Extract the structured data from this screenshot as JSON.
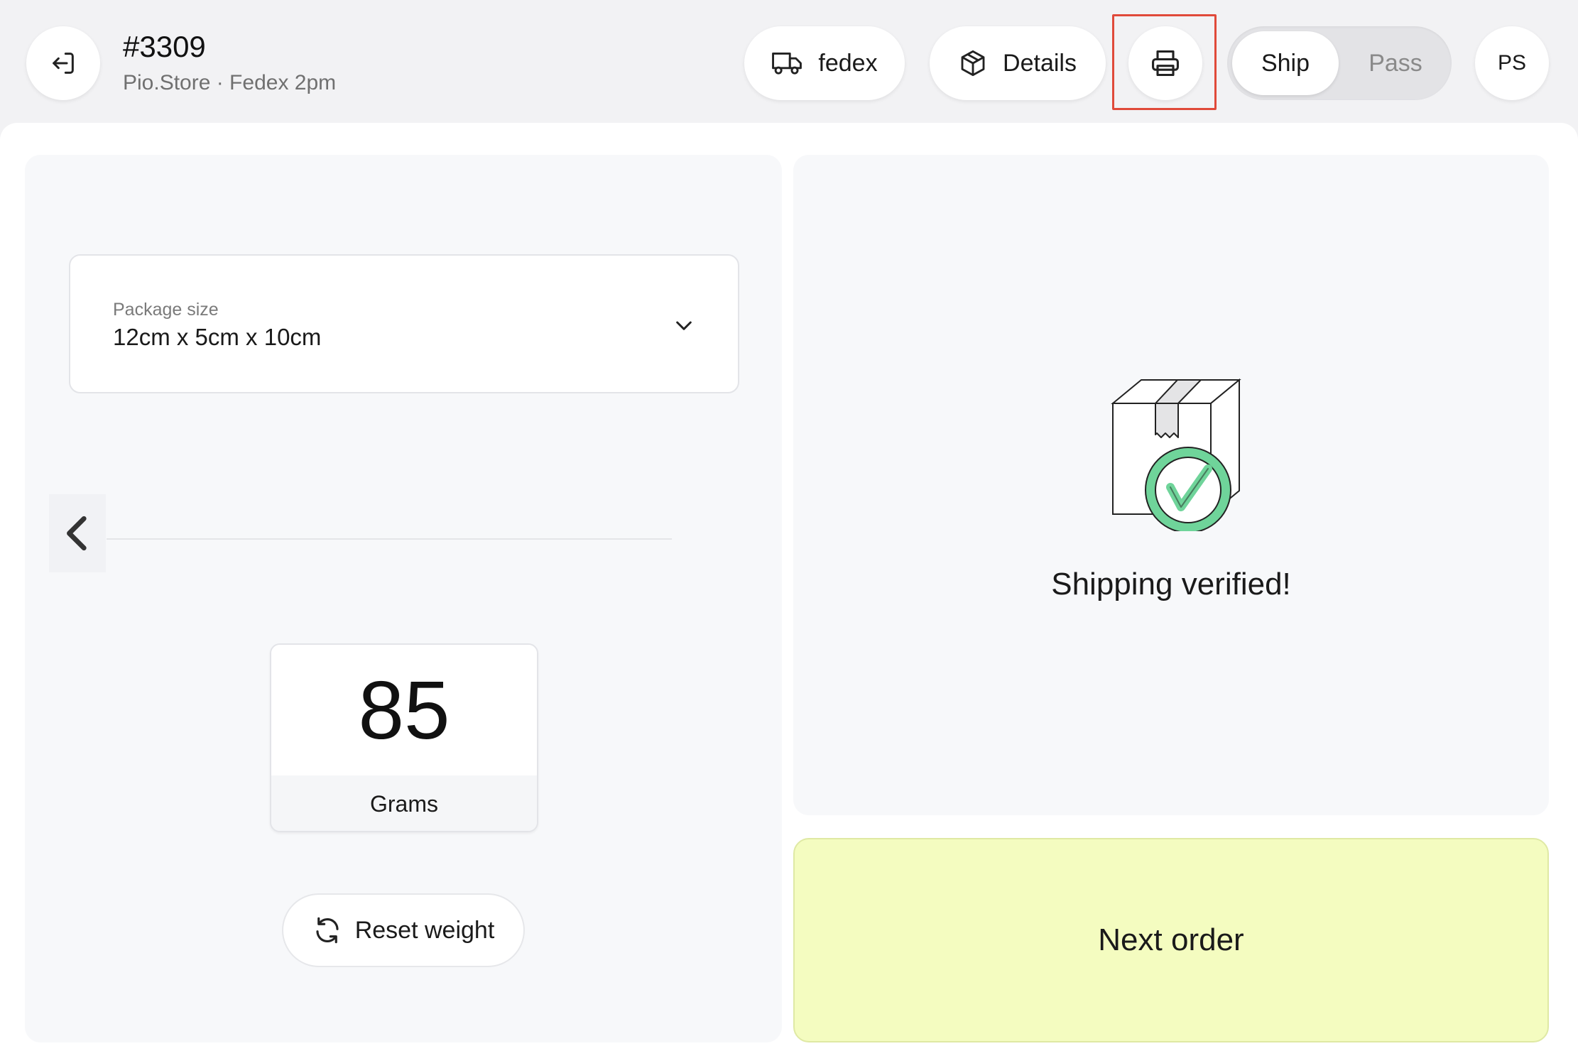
{
  "header": {
    "order_number": "#3309",
    "order_subtitle": "Pio.Store · Fedex 2pm",
    "carrier_label": "fedex",
    "details_label": "Details",
    "mode_toggle": {
      "active": "Ship",
      "inactive": "Pass"
    },
    "user_initials": "PS"
  },
  "package": {
    "label": "Package size",
    "value": "12cm x 5cm x 10cm"
  },
  "weight": {
    "value": "85",
    "unit": "Grams",
    "reset_label": "Reset weight"
  },
  "status": {
    "message": "Shipping verified!",
    "accent_color": "#6fd49a"
  },
  "actions": {
    "next_label": "Next order"
  },
  "icons": [
    "exit-icon",
    "truck-icon",
    "package-icon",
    "printer-icon",
    "chevron-down-icon",
    "chevron-left-icon",
    "refresh-icon",
    "verified-box-icon"
  ]
}
